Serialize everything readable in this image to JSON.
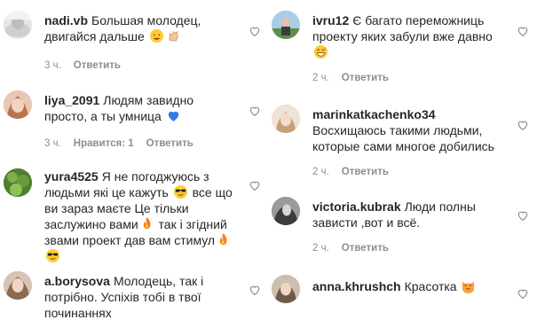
{
  "left": [
    {
      "username": "nadi.vb",
      "text": "Большая молодец, двигайся дальше",
      "emojis": [
        "star-struck-emoji",
        "clapping-hands-emoji"
      ],
      "time": "3 ч.",
      "likes": "",
      "reply": "Ответить",
      "avatar_color": "#d8d8d8"
    },
    {
      "username": "liya_2091",
      "text": "Людям завидно просто, а ты умница",
      "emojis": [
        "blue-heart-emoji"
      ],
      "time": "3 ч.",
      "likes": "Нравится: 1",
      "reply": "Ответить",
      "avatar_color": "#d9a38c"
    },
    {
      "username": "yura4525",
      "text1": "Я не погоджуюсь з людьми які це кажуть",
      "text2": "все що ви зараз маєте Це тільки заслужино вами",
      "text3": "так і згідний звами проект дав вам стимул",
      "emojis": [
        "sunglasses-emoji",
        "fire-emoji",
        "fire-emoji",
        "sunglasses-emoji"
      ],
      "time": "",
      "likes": "",
      "reply": "",
      "avatar_color": "#5c8f3a"
    },
    {
      "username": "a.borysova",
      "text": "Молодець, так і потрібно. Успіхів тобі в твої починаннях",
      "emojis": [],
      "time": "",
      "likes": "",
      "reply": "",
      "avatar_color": "#b9a08f"
    }
  ],
  "right": [
    {
      "username": "ivru12",
      "text": "Є багато переможниць проекту яких забули вже давно",
      "emojis": [
        "grinning-sweat-emoji"
      ],
      "time": "2 ч.",
      "likes": "",
      "reply": "Ответить",
      "avatar_color": "#8fb7d8"
    },
    {
      "username": "marinkatkachenko34",
      "text": "Восхищаюсь такими людьми, которые сами многое добились",
      "emojis": [],
      "time": "2 ч.",
      "likes": "",
      "reply": "Ответить",
      "avatar_color": "#d9c3b0"
    },
    {
      "username": "victoria.kubrak",
      "text": "Люди полны зависти ,вот и всё.",
      "emojis": [],
      "time": "2 ч.",
      "likes": "",
      "reply": "Ответить",
      "avatar_color": "#6b6b6b"
    },
    {
      "username": "anna.khrushch",
      "text": "Красотка",
      "emojis": [
        "cat-heart-eyes-emoji"
      ],
      "time": "",
      "likes": "",
      "reply": "",
      "avatar_color": "#a89a8a"
    }
  ],
  "colors": {
    "text": "#262626",
    "meta": "#8e8e8e",
    "heart_outline": "#8e8e8e",
    "blue_heart": "#2f7de1",
    "fire": "#ff7a1a",
    "emoji_yellow": "#ffcc33"
  }
}
